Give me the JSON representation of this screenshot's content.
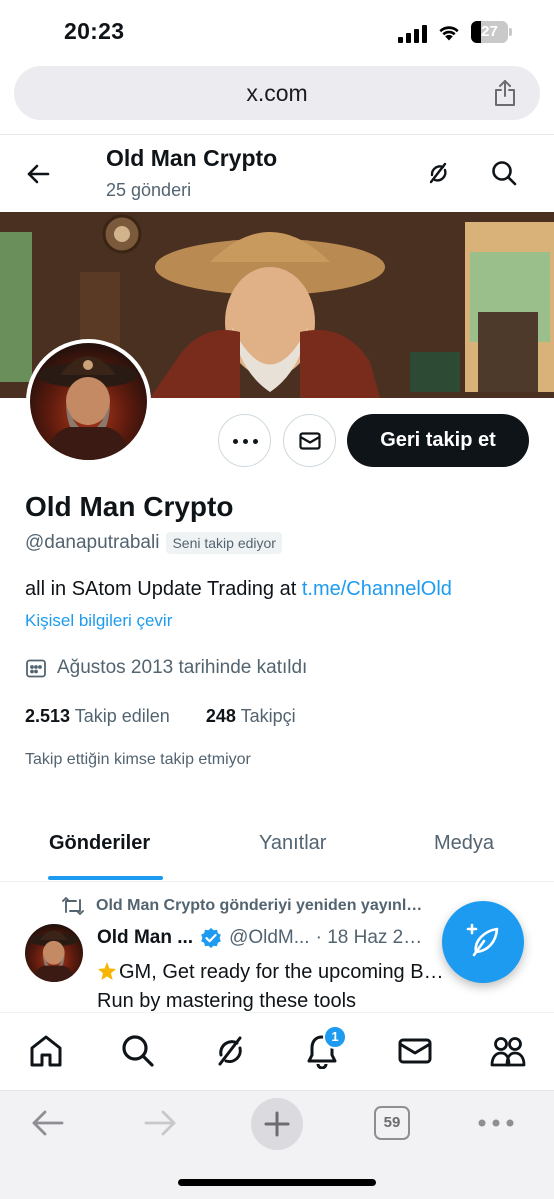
{
  "status_bar": {
    "time": "20:23",
    "battery": "27",
    "battery_level": 0.27
  },
  "browser": {
    "url": "x.com",
    "tab_count": "59"
  },
  "profile_header": {
    "title": "Old Man Crypto",
    "post_count": "25 gönderi"
  },
  "actions": {
    "follow_back_label": "Geri takip et"
  },
  "profile": {
    "display_name": "Old Man Crypto",
    "username": "@danaputrabali",
    "follows_you": "Seni takip ediyor",
    "bio_text": "all in SAtom Update Trading at ",
    "bio_link": "t.me/ChannelOld",
    "translate_label": "Kişisel bilgileri çevir",
    "joined": "Ağustos 2013 tarihinde katıldı",
    "following_count": "2.513",
    "following_label": "Takip edilen",
    "followers_count": "248",
    "followers_label": "Takipçi",
    "followed_by_note": "Takip ettiğin kimse takip etmiyor"
  },
  "tabs": [
    {
      "label": "Gönderiler",
      "active": true
    },
    {
      "label": "Yanıtlar",
      "active": false
    },
    {
      "label": "Medya",
      "active": false
    }
  ],
  "post": {
    "repost_label": "Old Man Crypto gönderiyi yeniden yayınl…",
    "author": "Old Man ...",
    "handle": "@OldM...",
    "date": "· 18 Haz 2…",
    "line1": "GM, Get ready for the upcoming B…",
    "line2": "Run by mastering these tools"
  },
  "bottom_nav": {
    "items": [
      "home-icon",
      "search-icon",
      "grok-icon",
      "notifications-icon",
      "messages-icon",
      "communities-icon"
    ],
    "notification_badge": "1"
  },
  "colors": {
    "accent": "#1d9bf0",
    "text": "#0f1419",
    "secondary": "#536471",
    "button_dark": "#0f1419"
  }
}
